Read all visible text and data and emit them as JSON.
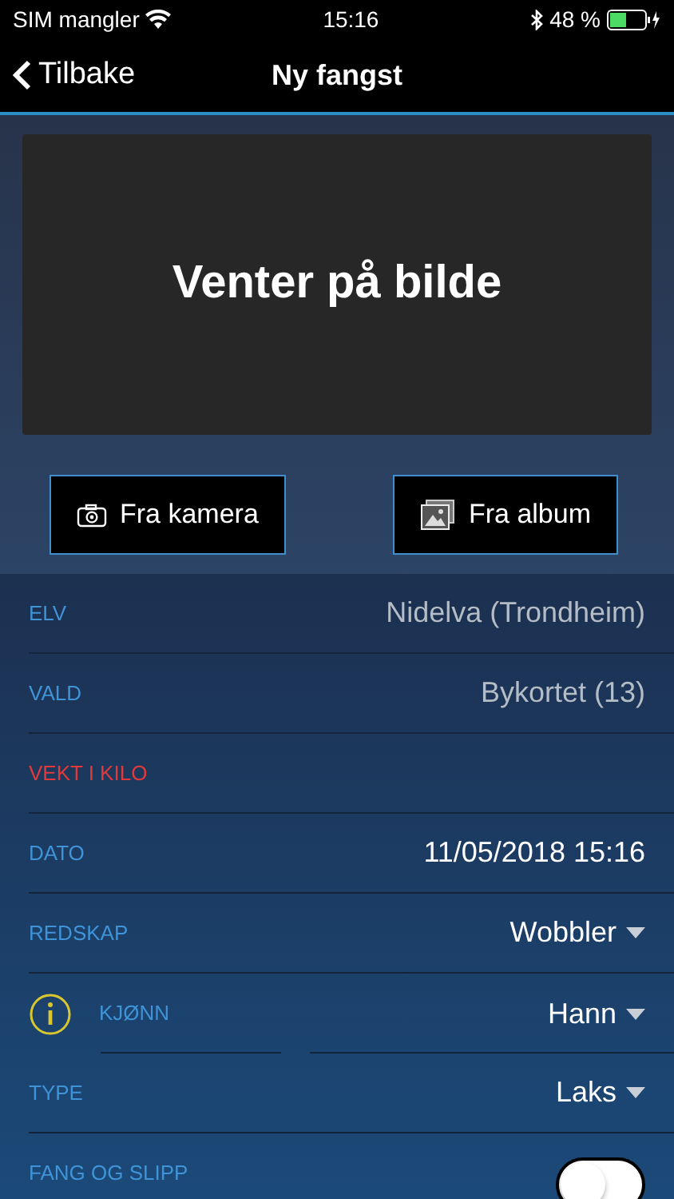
{
  "status_bar": {
    "carrier": "SIM mangler",
    "time": "15:16",
    "battery": "48 %"
  },
  "nav": {
    "back": "Tilbake",
    "title": "Ny fangst"
  },
  "photo": {
    "placeholder": "Venter på bilde"
  },
  "buttons": [
    {
      "kind": "camera",
      "label": "Fra kamera"
    },
    {
      "kind": "album",
      "label": "Fra album"
    }
  ],
  "fields": [
    {
      "kind": "readonly",
      "label": "ELV",
      "value": "Nidelva (Trondheim)",
      "error": false
    },
    {
      "kind": "readonly",
      "label": "VALD",
      "value": "Bykortet (13)",
      "error": false
    },
    {
      "kind": "input",
      "label": "VEKT I KILO",
      "error": true
    },
    {
      "kind": "text",
      "label": "DATO",
      "value": "11/05/2018 15:16",
      "error": false
    },
    {
      "kind": "dropdown",
      "label": "REDSKAP",
      "value": "Wobbler",
      "error": false
    },
    {
      "kind": "dropdown",
      "label": "KJØNN",
      "value": "Hann",
      "info": true,
      "error": false
    },
    {
      "kind": "dropdown",
      "label": "TYPE",
      "value": "Laks",
      "error": false
    },
    {
      "kind": "toggle",
      "label": "FANG OG SLIPP",
      "on": false,
      "error": false
    }
  ]
}
